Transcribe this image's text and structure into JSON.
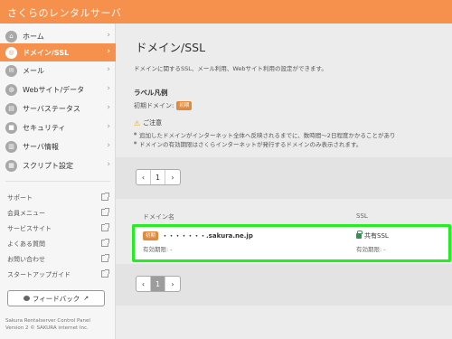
{
  "app": {
    "brand": "さくらのレンタルサーバ"
  },
  "sidebar": {
    "items": [
      {
        "label": "ホーム",
        "icon": "home-icon",
        "glyph": "⌂"
      },
      {
        "label": "ドメイン/SSL",
        "icon": "domain-icon",
        "glyph": "◎",
        "active": true
      },
      {
        "label": "メール",
        "icon": "mail-icon",
        "glyph": "✉"
      },
      {
        "label": "Webサイト/データ",
        "icon": "globe-icon",
        "glyph": "◍"
      },
      {
        "label": "サーバステータス",
        "icon": "chart-icon",
        "glyph": "▤"
      },
      {
        "label": "セキュリティ",
        "icon": "lock-icon",
        "glyph": "■"
      },
      {
        "label": "サーバ情報",
        "icon": "server-icon",
        "glyph": "▥"
      },
      {
        "label": "スクリプト設定",
        "icon": "script-icon",
        "glyph": "▦"
      }
    ],
    "links": [
      "サポート",
      "会員メニュー",
      "サービスサイト",
      "よくある質問",
      "お問い合わせ",
      "スタートアップガイド"
    ],
    "feedback_label": "フィードバック",
    "footer_line1": "Sakura Rentalserver Control Panel",
    "footer_line2": "Version 2 © SAKURA internet Inc."
  },
  "main": {
    "title": "ドメイン/SSL",
    "description": "ドメインに関するSSL、メール利用、Webサイト利用の設定ができます。",
    "legend_heading": "ラベル凡例",
    "legend_label": "初期ドメイン:",
    "legend_badge": "初期",
    "notice_heading": "ご注意",
    "notice_lines": [
      "追加したドメインがインターネット全体へ反映されるまでに、数時間〜2日程度かかることがあり",
      "ドメインの有効期限はさくらインターネットが発行するドメインのみ表示されます。"
    ],
    "pager": {
      "prev": "‹",
      "page": "1",
      "next": "›"
    },
    "table": {
      "col_domain": "ドメイン名",
      "col_ssl": "SSL",
      "row": {
        "badge": "初期",
        "domain": "・・・・・・・.sakura.ne.jp",
        "expiry_label": "有効期限: -",
        "ssl_status": "共有SSL",
        "ssl_expiry": "有効期限: -"
      }
    }
  },
  "colors": {
    "accent": "#f5914d",
    "highlight": "#22ee22",
    "badge": "#e08a3c"
  }
}
